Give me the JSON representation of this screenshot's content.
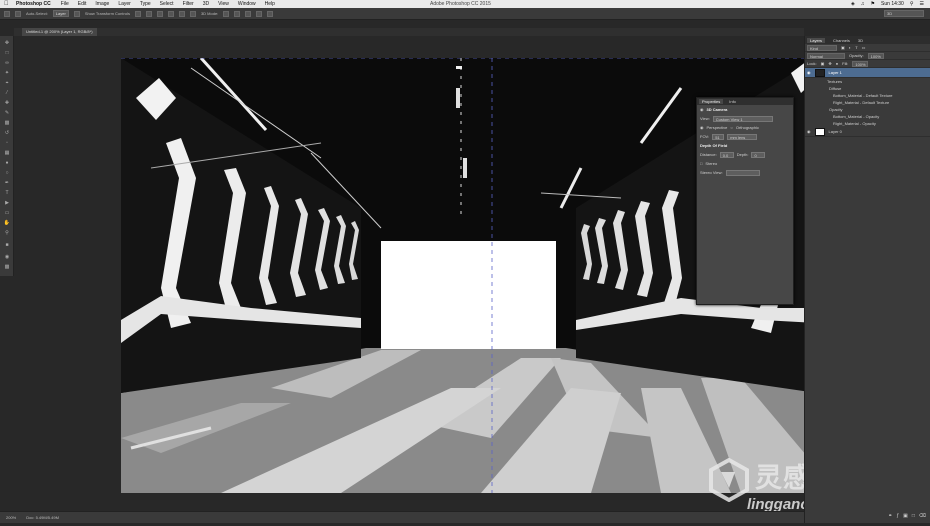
{
  "menubar": {
    "app": "Photoshop CC",
    "items": [
      "File",
      "Edit",
      "Image",
      "Layer",
      "Type",
      "Select",
      "Filter",
      "3D",
      "View",
      "Window",
      "Help"
    ],
    "window_title": "Adobe Photoshop CC 2015",
    "clock": "Sun 14:30"
  },
  "options": {
    "auto_select": "Auto-Select:",
    "auto_select_value": "Layer",
    "show_transform": "Show Transform Controls",
    "mode_3d": "3D Mode:",
    "workspace": "3D"
  },
  "document": {
    "tab_title": "Untitled-1 @ 200% (Layer 1, RGB/8*)"
  },
  "status": {
    "zoom": "200%",
    "doc_info": "Doc: 5.49M/5.49M"
  },
  "layers_panel": {
    "tabs": [
      "Layers",
      "Channels",
      "3D"
    ],
    "kind": "Kind",
    "blend_mode": "Normal",
    "opacity_label": "Opacity:",
    "opacity_value": "100%",
    "lock_label": "Lock:",
    "fill_label": "Fill:",
    "fill_value": "100%",
    "layer1": "Layer 1",
    "textures": "Textures",
    "diffuse": "Diffuse",
    "tex1": "Bottom_Material - Default Texture",
    "tex2": "Right_Material - Default Texture",
    "opacity_group": "Opacity",
    "op1": "Bottom_Material - Opacity",
    "op2": "Right_Material - Opacity",
    "layer0": "Layer 0"
  },
  "properties_panel": {
    "tabs": [
      "Properties",
      "Info"
    ],
    "heading": "3D Camera",
    "view_label": "View:",
    "view_value": "Custom View 1",
    "perspective": "Perspective",
    "orthographic": "Orthographic",
    "fov_label": "FOV:",
    "fov_value": "51",
    "fov_unit": "mm lens",
    "dof_heading": "Depth Of Field",
    "distance_label": "Distance:",
    "distance_value": "0.0",
    "depth_label": "Depth:",
    "depth_value": "0",
    "stereo": "Stereo",
    "stereo_view_label": "Stereo View:"
  },
  "watermark": {
    "cn": "灵感中国",
    "en": "lingganchina.com"
  },
  "colors": {
    "selection_blue": "#4d6c91",
    "chrome": "#3a3a3a"
  }
}
